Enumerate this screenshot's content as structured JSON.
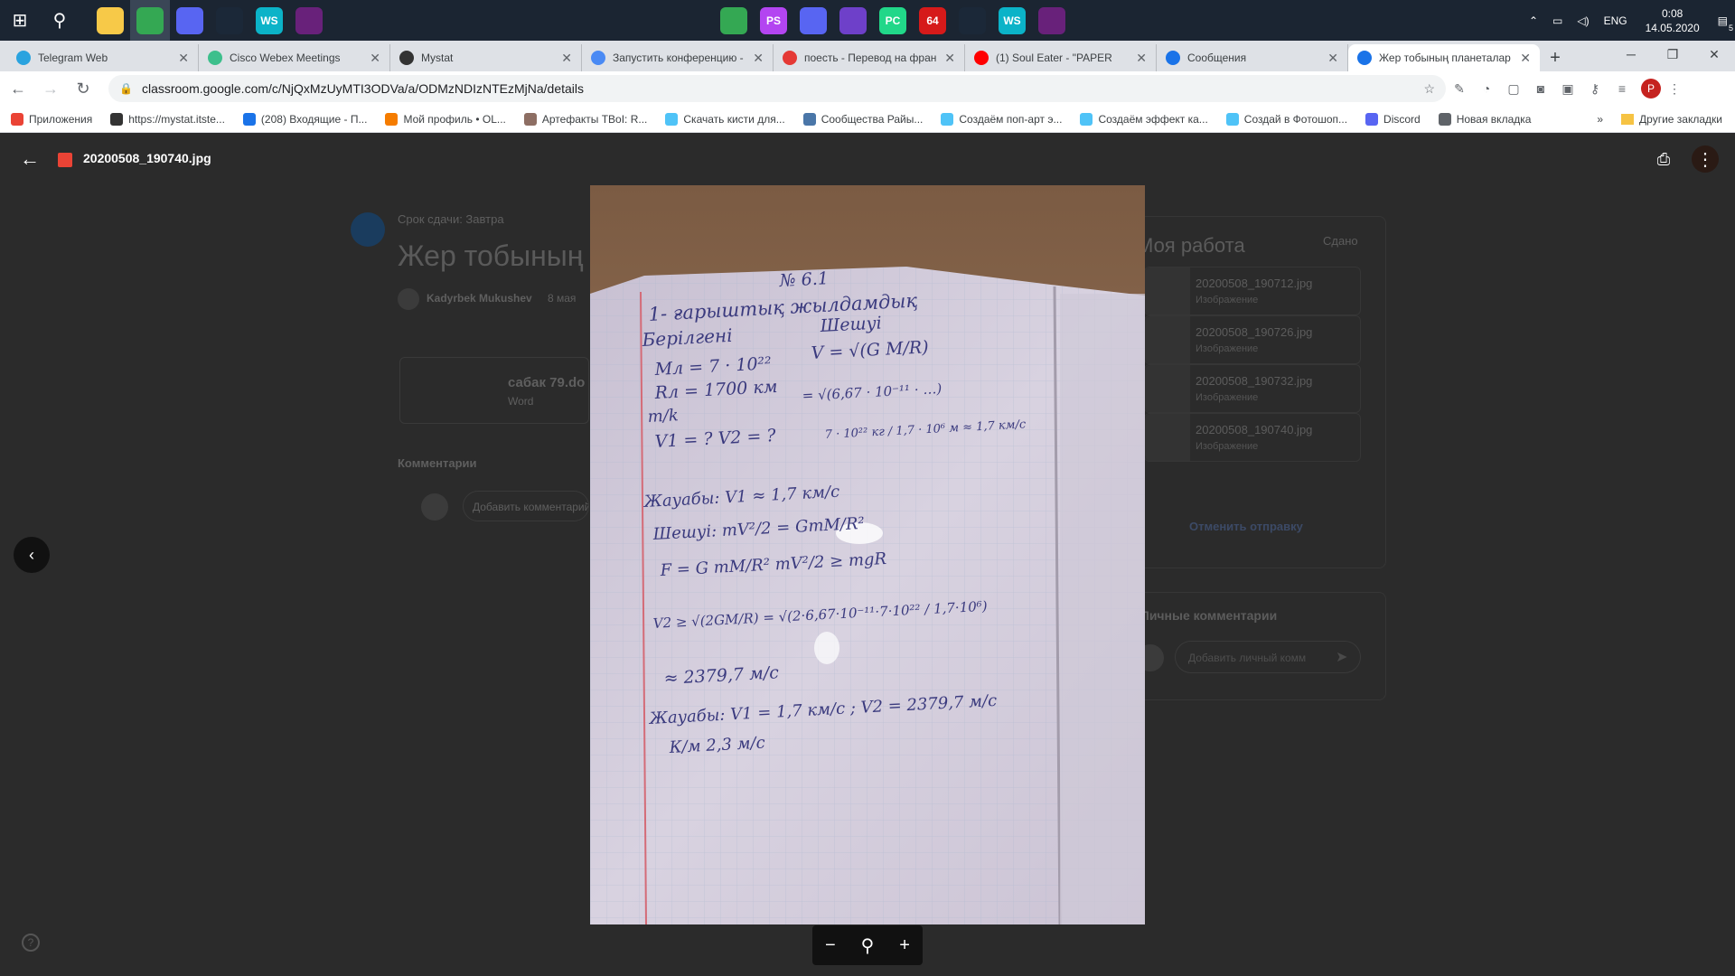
{
  "taskbar": {
    "apps": [
      {
        "name": "file-explorer-icon",
        "color": "#f7c948",
        "label": ""
      },
      {
        "name": "chrome-icon",
        "color": "#34a853",
        "label": ""
      },
      {
        "name": "discord-icon",
        "color": "#5865f2",
        "label": ""
      },
      {
        "name": "steam-icon",
        "color": "#1b2838",
        "label": ""
      },
      {
        "name": "webstorm-icon",
        "color": "#0bb3c8",
        "label": "WS"
      },
      {
        "name": "visual-studio-icon",
        "color": "#68217a",
        "label": ""
      }
    ],
    "center_apps": [
      {
        "name": "chrome-icon",
        "color": "#34a853",
        "label": ""
      },
      {
        "name": "phpstorm-icon",
        "color": "#b345f1",
        "label": "PS"
      },
      {
        "name": "discord-icon",
        "color": "#5865f2",
        "label": ""
      },
      {
        "name": "github-desktop-icon",
        "color": "#6e40c9",
        "label": ""
      },
      {
        "name": "pycharm-icon",
        "color": "#21d789",
        "label": "PC"
      },
      {
        "name": "sixtyfour-icon",
        "color": "#d61a1a",
        "label": "64"
      },
      {
        "name": "steam-icon",
        "color": "#1b2838",
        "label": ""
      },
      {
        "name": "webstorm-icon",
        "color": "#0bb3c8",
        "label": "WS"
      },
      {
        "name": "visual-studio-icon",
        "color": "#68217a",
        "label": ""
      }
    ],
    "language": "ENG",
    "time": "0:08",
    "date": "14.05.2020",
    "notifications": "5"
  },
  "tabs": [
    {
      "title": "Telegram Web",
      "color": "#2aa3df"
    },
    {
      "title": "Cisco Webex Meetings",
      "color": "#3dbf8c"
    },
    {
      "title": "Mystat",
      "color": "#333333"
    },
    {
      "title": "Запустить конференцию -",
      "color": "#4a8af4"
    },
    {
      "title": "поесть - Перевод на фран",
      "color": "#e53935"
    },
    {
      "title": "(1) Soul Eater - \"PAPER",
      "color": "#ff0000"
    },
    {
      "title": "Сообщения",
      "color": "#1a73e8"
    },
    {
      "title": "Жер тобының планеталар",
      "color": "#1a73e8"
    }
  ],
  "address": {
    "url": "classroom.google.com/c/NjQxMzUyMTI3ODVa/a/ODMzNDIzNTEzMjNa/details"
  },
  "bookmarks": [
    {
      "label": "Приложения",
      "color": "#ea4335"
    },
    {
      "label": "https://mystat.itste...",
      "color": "#333333"
    },
    {
      "label": "(208) Входящие - П...",
      "color": "#1a73e8"
    },
    {
      "label": "Мой профиль • OL...",
      "color": "#f57c00"
    },
    {
      "label": "Артефакты TBoI: R...",
      "color": "#8d6e63"
    },
    {
      "label": "Скачать кисти для...",
      "color": "#4fc3f7"
    },
    {
      "label": "Сообщества Райы...",
      "color": "#4a76a8"
    },
    {
      "label": "Создаём поп-арт э...",
      "color": "#4fc3f7"
    },
    {
      "label": "Создаём эффект ка...",
      "color": "#4fc3f7"
    },
    {
      "label": "Создай в Фотошоп...",
      "color": "#4fc3f7"
    },
    {
      "label": "Discord",
      "color": "#5865f2"
    },
    {
      "label": "Новая вкладка",
      "color": "#5f6368"
    }
  ],
  "bookmarks_other": "Другие закладки",
  "profile_initial": "P",
  "classroom": {
    "due": "Срок сдачи: Завтра",
    "title": "Жер тобының",
    "author": "Kadyrbek Mukushev",
    "date": "8 мая",
    "attachment_name": "сабак 79.do",
    "attachment_type": "Word",
    "comments_label": "Комментарии",
    "comment_placeholder": "Добавить комментарий",
    "my_work": "Моя работа",
    "status": "Сдано",
    "files": [
      {
        "name": "20200508_190712.jpg",
        "type": "Изображение"
      },
      {
        "name": "20200508_190726.jpg",
        "type": "Изображение"
      },
      {
        "name": "20200508_190732.jpg",
        "type": "Изображение"
      },
      {
        "name": "20200508_190740.jpg",
        "type": "Изображение"
      }
    ],
    "unsubmit": "Отменить отправку",
    "private_comments": "Личные комментарии",
    "private_placeholder": "Добавить личный комм"
  },
  "viewer": {
    "filename": "20200508_190740.jpg",
    "notes": [
      "№ 6.1",
      "1- ғарыштық жылдамдық",
      "Берілгені",
      "Шешуі",
      "Mл = 7 · 10²²",
      "Rл = 1700 км",
      "m/k",
      "V1 = ?   V2 = ?",
      "V = √(G M/R)",
      "= √(6,67 · 10⁻¹¹ · …)",
      "7 · 10²² кг / 1,7 · 10⁶ м ≈ 1,7 км/с",
      "Жауабы: V1 ≈ 1,7 км/с",
      "Шешуі:  mV²/2 = GmM/R²",
      "F = G mM/R²    mV²/2 ≥ mgR",
      "V2 ≥ √(2GM/R) = √(2·6,67·10⁻¹¹·7·10²² / 1,7·10⁶)",
      "≈ 2379,7 м/с",
      "Жауабы: V1 = 1,7 км/с ; V2 = 2379,7 м/с",
      "К/м  2,3 м/с"
    ]
  }
}
